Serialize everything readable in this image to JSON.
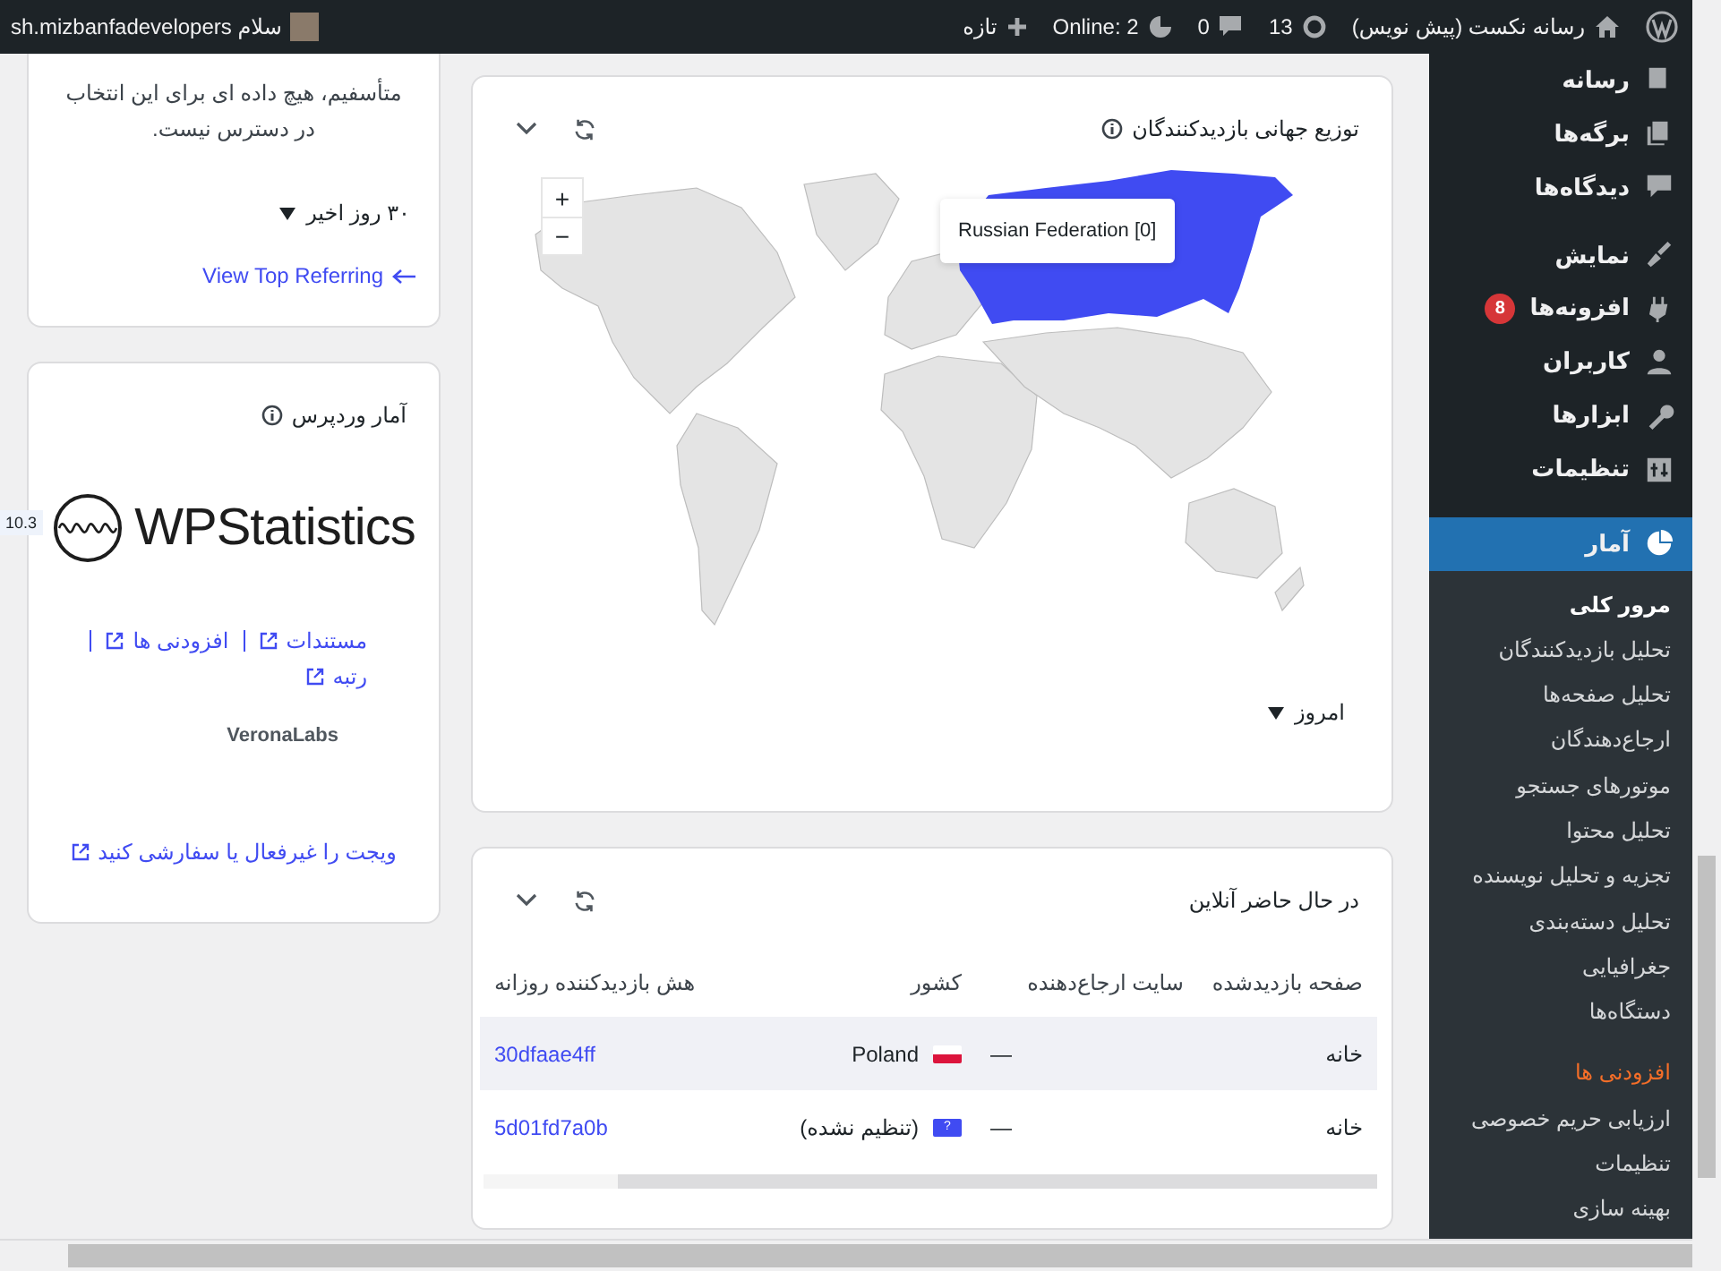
{
  "admin_bar": {
    "site_title": "رسانه نکست (پیش نویس)",
    "updates": "13",
    "comments": "0",
    "online": "Online: 2",
    "new": "تازه",
    "greeting": "سلام sh.mizbanfadevelopers"
  },
  "referrals_card": {
    "message": "متأسفیم، هیچ داده ای برای این انتخاب در دسترس نیست.",
    "period": "۳۰ روز اخیر",
    "link": "View Top Referring"
  },
  "wp_statistics_card": {
    "title": "آمار وردپرس",
    "version": "10.3",
    "logo": "WPStatistics",
    "links": [
      "مستندات",
      "افزودنی ها",
      "رتبه"
    ],
    "vendor": "VeronaLabs",
    "footer_link": "ویجت را غیرفعال یا سفارشی کنید"
  },
  "map_card": {
    "title": "توزیع جهانی بازدیدکنندگان",
    "tooltip": "Russian Federation [0]",
    "zoom_in": "+",
    "zoom_out": "−",
    "period": "امروز"
  },
  "online_card": {
    "title": "در حال حاضر آنلاین",
    "columns": [
      "صفحه بازدیدشده",
      "سایت ارجاع‌دهنده",
      "کشور",
      "هش بازدیدکننده روزانه"
    ],
    "rows": [
      {
        "page": "خانه",
        "referrer": "—",
        "country": "Poland",
        "kind": "flag",
        "hash": "30dfaae4ff",
        "highlighted": true
      },
      {
        "page": "خانه",
        "referrer": "—",
        "country": "(تنظیم نشده)",
        "kind": "unknown",
        "flag_text": "?",
        "hash": "5d01fd7a0b",
        "highlighted": false
      }
    ]
  },
  "sidebar": {
    "items": [
      {
        "label": "رسانه",
        "selected": false
      },
      {
        "label": "برگه‌ها",
        "selected": false
      },
      {
        "label": "دیدگاه‌ها",
        "selected": false
      },
      {
        "label": "نمایش",
        "selected": false
      },
      {
        "label": "افزونه‌ها",
        "selected": false,
        "badge": "8"
      },
      {
        "label": "کاربران",
        "selected": false
      },
      {
        "label": "ابزارها",
        "selected": false
      },
      {
        "label": "تنظیمات",
        "selected": false
      },
      {
        "label": "آمار",
        "selected": true
      }
    ],
    "submenu": [
      {
        "label": "مرور کلی",
        "selected": true,
        "accent": false
      },
      {
        "label": "تحلیل بازدیدکنندگان",
        "selected": false,
        "accent": false
      },
      {
        "label": "تحلیل صفحه‌ها",
        "selected": false,
        "accent": false
      },
      {
        "label": "ارجاع‌دهندگان",
        "selected": false,
        "accent": false
      },
      {
        "label": "موتورهای جستجو",
        "selected": false,
        "accent": false
      },
      {
        "label": "تحلیل محتوا",
        "selected": false,
        "accent": false
      },
      {
        "label": "تجزیه و تحلیل نویسنده",
        "selected": false,
        "accent": false
      },
      {
        "label": "تحلیل دسته‌بندی",
        "selected": false,
        "accent": false
      },
      {
        "label": "جغرافیایی",
        "selected": false,
        "accent": false
      },
      {
        "label": "دستگاه‌ها",
        "selected": false,
        "accent": false
      },
      {
        "label": "افزودنی ها",
        "selected": false,
        "accent": true
      },
      {
        "label": "ارزیابی حریم خصوصی",
        "selected": false,
        "accent": false
      },
      {
        "label": "تنظیمات",
        "selected": false,
        "accent": false
      },
      {
        "label": "بهینه سازی",
        "selected": false,
        "accent": false
      }
    ]
  }
}
